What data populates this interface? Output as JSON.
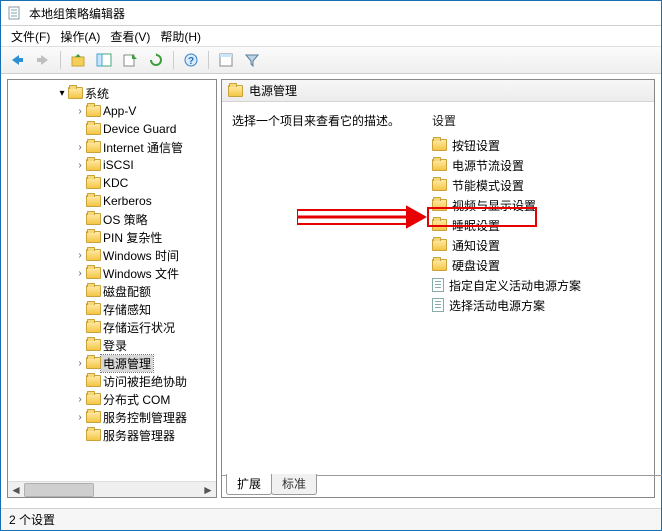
{
  "window": {
    "title": "本地组策略编辑器"
  },
  "menubar": {
    "file": {
      "label": "文件(F)"
    },
    "action": {
      "label": "操作(A)"
    },
    "view": {
      "label": "查看(V)"
    },
    "help": {
      "label": "帮助(H)"
    }
  },
  "tree": {
    "root_label": "系统",
    "items": [
      {
        "label": "App-V",
        "expandable": true
      },
      {
        "label": "Device Guard",
        "expandable": false
      },
      {
        "label": "Internet 通信管",
        "expandable": true
      },
      {
        "label": "iSCSI",
        "expandable": true
      },
      {
        "label": "KDC",
        "expandable": false
      },
      {
        "label": "Kerberos",
        "expandable": false
      },
      {
        "label": "OS 策略",
        "expandable": false
      },
      {
        "label": "PIN 复杂性",
        "expandable": false
      },
      {
        "label": "Windows 时间",
        "expandable": true
      },
      {
        "label": "Windows 文件",
        "expandable": true
      },
      {
        "label": "磁盘配额",
        "expandable": false
      },
      {
        "label": "存储感知",
        "expandable": false
      },
      {
        "label": "存储运行状况",
        "expandable": false
      },
      {
        "label": "登录",
        "expandable": false
      },
      {
        "label": "电源管理",
        "expandable": true,
        "selected": true
      },
      {
        "label": "访问被拒绝协助",
        "expandable": false
      },
      {
        "label": "分布式 COM",
        "expandable": true
      },
      {
        "label": "服务控制管理器",
        "expandable": true
      },
      {
        "label": "服务器管理器",
        "expandable": false
      }
    ]
  },
  "right": {
    "header": "电源管理",
    "description": "选择一个项目来查看它的描述。",
    "settings_header": "设置",
    "items": [
      {
        "label": "按钮设置",
        "type": "folder"
      },
      {
        "label": "电源节流设置",
        "type": "folder"
      },
      {
        "label": "节能模式设置",
        "type": "folder"
      },
      {
        "label": "视频与显示设置",
        "type": "folder"
      },
      {
        "label": "睡眠设置",
        "type": "folder",
        "highlighted": true
      },
      {
        "label": "通知设置",
        "type": "folder"
      },
      {
        "label": "硬盘设置",
        "type": "folder"
      },
      {
        "label": "指定自定义活动电源方案",
        "type": "policy"
      },
      {
        "label": "选择活动电源方案",
        "type": "policy"
      }
    ]
  },
  "tabs": {
    "extended": "扩展",
    "standard": "标准"
  },
  "statusbar": {
    "text": "2 个设置"
  }
}
